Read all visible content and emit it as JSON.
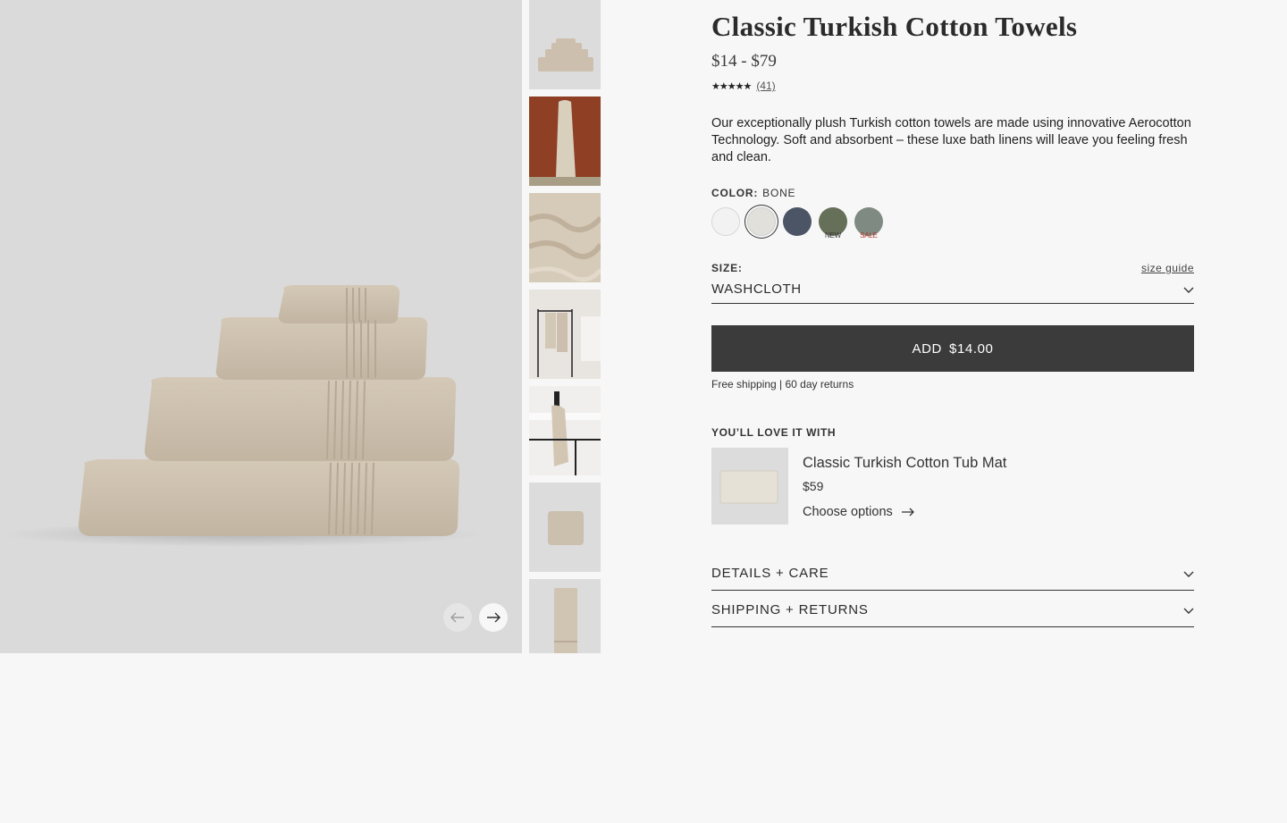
{
  "product": {
    "title": "Classic Turkish Cotton Towels",
    "price_range": "$14 - $79",
    "rating_stars": "★★★★★",
    "rating_value": 4.6,
    "review_count": "(41)",
    "description": "Our exceptionally plush Turkish cotton towels are made using innovative Aerocotton Technology. Soft and absorbent – these luxe bath linens will leave you feeling fresh and clean."
  },
  "color": {
    "label": "COLOR:",
    "selected": "BONE",
    "swatches": [
      {
        "name": "white",
        "hex": "#f2f2f2",
        "tag": ""
      },
      {
        "name": "bone",
        "hex": "#e2e0da",
        "tag": ""
      },
      {
        "name": "slate-blue",
        "hex": "#4c5566",
        "tag": ""
      },
      {
        "name": "olive",
        "hex": "#667058",
        "tag": "NEW",
        "tag_color": "#333333"
      },
      {
        "name": "sage-gray",
        "hex": "#7f8a83",
        "tag": "SALE",
        "tag_color": "#b03a2e"
      }
    ]
  },
  "size": {
    "label": "SIZE:",
    "guide_label": "size guide",
    "selected": "WASHCLOTH"
  },
  "cart": {
    "add_label": "ADD",
    "add_price": "$14.00",
    "shipping_note": "Free shipping | 60 day returns"
  },
  "upsell": {
    "heading": "YOU’LL LOVE IT WITH",
    "name": "Classic Turkish Cotton Tub Mat",
    "price": "$59",
    "link_label": "Choose options"
  },
  "accordions": [
    {
      "label": "DETAILS + CARE"
    },
    {
      "label": "SHIPPING + RETURNS"
    }
  ],
  "gallery": {
    "thumb_count": 7,
    "colors": {
      "hero_bg": "#dadada",
      "towel": "#cfc3b2",
      "towel_shadow": "#b8ab99",
      "accent_wall": "#8e3f24"
    }
  }
}
